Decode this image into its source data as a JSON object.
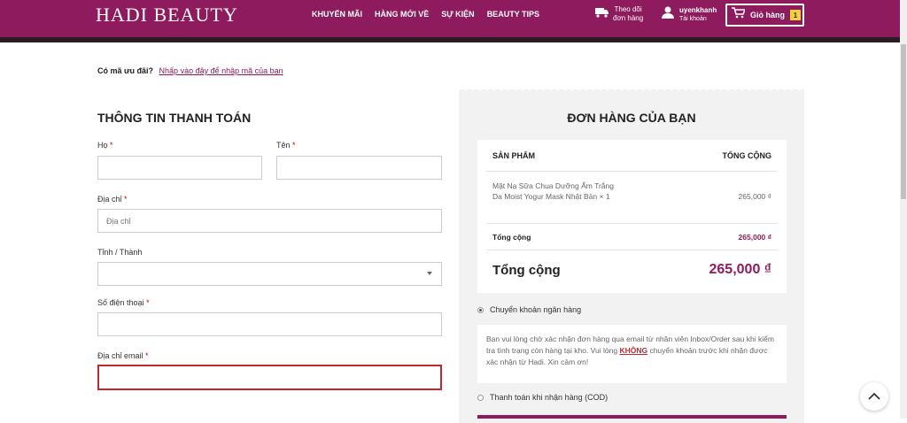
{
  "header": {
    "logo": "HADI BEAUTY",
    "nav": [
      "KHUYẾN MÃI",
      "HÀNG MỚI VỀ",
      "SỰ KIỆN",
      "BEAUTY TIPS"
    ],
    "track_line1": "Theo dõi",
    "track_line2": "đơn hàng",
    "user_name": "uyenkhanh",
    "user_sub": "Tài khoản",
    "cart_label": "Giỏ hàng",
    "cart_count": "1"
  },
  "coupon": {
    "question": "Có mã ưu đãi?",
    "link": "Nhấp vào đây để nhập mã của bạn"
  },
  "billing": {
    "title": "THÔNG TIN THANH TOÁN",
    "last_name_label": "Họ",
    "first_name_label": "Tên",
    "address_label": "Địa chỉ",
    "address_placeholder": "Địa chỉ",
    "province_label": "Tỉnh / Thành",
    "phone_label": "Số điện thoại",
    "email_label": "Địa chỉ email",
    "required_mark": "*"
  },
  "order": {
    "title": "ĐƠN HÀNG CỦA BẠN",
    "col_product": "SẢN PHẨM",
    "col_total": "TỔNG CỘNG",
    "item_line1": "Mặt Nạ Sữa Chua Dưỡng Ẩm Trắng",
    "item_line2": "Da Moist Yogur Mask Nhật Bản",
    "item_qty": "× 1",
    "item_price": "265,000 ₫",
    "subtotal_label": "Tổng cộng",
    "subtotal_value": "265,000 ₫",
    "grand_label": "Tổng cộng",
    "grand_value": "265,000 ₫"
  },
  "payment": {
    "bank_label": "Chuyển khoản ngân hàng",
    "bank_note_before": "Bạn vui lòng chờ xác nhận đơn hàng qua email từ nhân viên Inbox/Order sau khi kiểm tra tình trạng còn hàng tại kho. Vui lòng",
    "bank_note_highlight": "KHÔNG",
    "bank_note_after": "chuyển khoản trước khi nhận được xác nhận từ Hadi. Xin cảm ơn!",
    "cod_label": "Thanh toán khi nhận hàng (COD)"
  },
  "colors": {
    "brand": "#8e1b5d",
    "error": "#c0282f",
    "badge": "#f4d03f"
  },
  "icons": [
    "truck-icon",
    "user-icon",
    "cart-icon",
    "chevron-down-icon",
    "chevron-up-icon"
  ]
}
